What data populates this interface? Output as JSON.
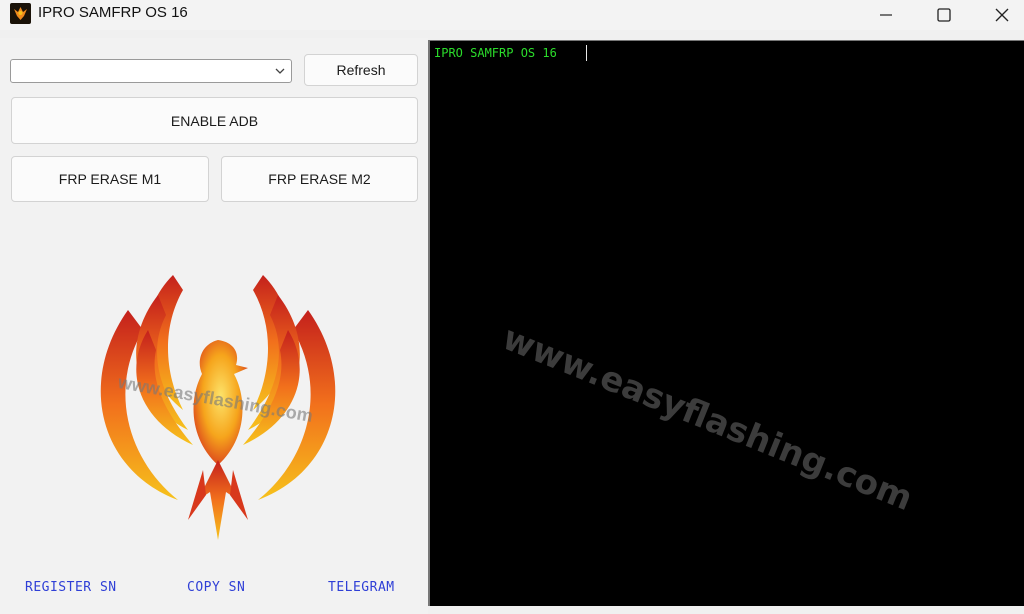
{
  "window": {
    "title": "IPRO SAMFRP OS 16",
    "app_icon": "phoenix-icon",
    "controls": [
      "minimize-icon",
      "maximize-icon",
      "close-icon"
    ]
  },
  "toolbar": {
    "device_select_value": "",
    "refresh_label": "Refresh"
  },
  "actions": {
    "enable_adb_label": "ENABLE ADB",
    "frp_erase_m1_label": "FRP ERASE M1",
    "frp_erase_m2_label": "FRP ERASE M2"
  },
  "logo": {
    "icon": "phoenix-logo",
    "watermark": "www.easyflashing.com",
    "colors": [
      "#f6c21c",
      "#f2711c",
      "#c4201c"
    ]
  },
  "footer": {
    "register_label": "REGISTER SN",
    "copy_label": "COPY SN",
    "telegram_label": "TELEGRAM",
    "link_color": "#2f3fd6"
  },
  "console": {
    "text": "IPRO SAMFRP OS 16",
    "text_color": "#2bdc2b",
    "background": "#000000",
    "watermark": "www.easyflashing.com"
  }
}
